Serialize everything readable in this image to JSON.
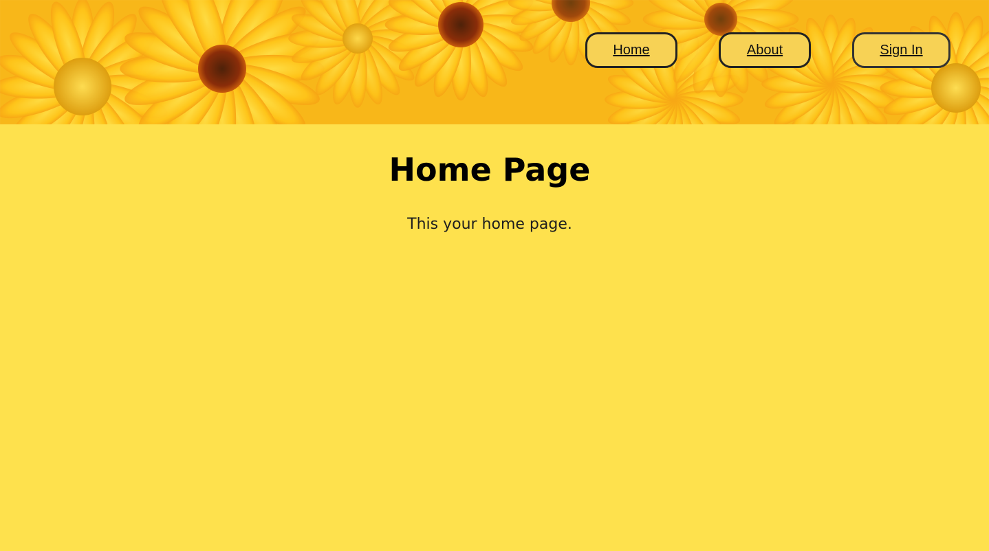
{
  "header": {
    "banner_image": "yellow-orange-flowers",
    "navigation": [
      {
        "label": "Home"
      },
      {
        "label": "About"
      },
      {
        "label": "Sign In"
      }
    ]
  },
  "main": {
    "title": "Home Page",
    "message": "This your home page."
  },
  "colors": {
    "page_background": "#fee14d",
    "button_background": "#f7d255",
    "button_border": "#222222",
    "text": "#000000"
  }
}
